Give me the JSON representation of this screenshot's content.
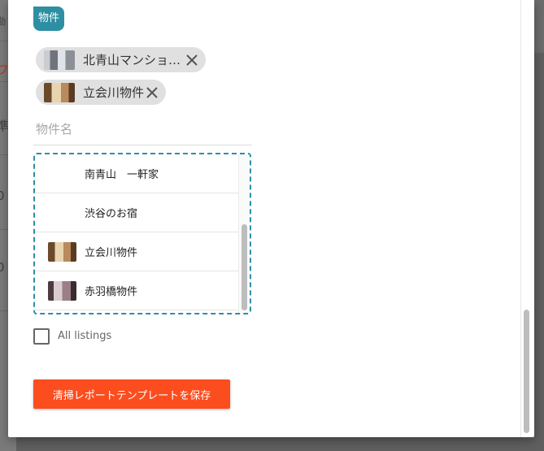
{
  "section": {
    "title": "物件"
  },
  "selected_chips": [
    {
      "label": "北青山マンショ…",
      "thumb_color": "#8b8f96"
    },
    {
      "label": "立会川物件",
      "thumb_color": "#b88a5e"
    }
  ],
  "name_input": {
    "placeholder": "物件名",
    "value": ""
  },
  "listings": [
    {
      "label": "南青山　一軒家",
      "has_thumb": false
    },
    {
      "label": "渋谷のお宿",
      "has_thumb": false
    },
    {
      "label": "立会川物件",
      "has_thumb": true,
      "thumb_color": "#b88a5e"
    },
    {
      "label": "赤羽橋物件",
      "has_thumb": true,
      "thumb_color": "#9a7f86"
    }
  ],
  "all_listings": {
    "label": "All listings",
    "checked": false
  },
  "save_button": {
    "label": "清掃レポートテンプレートを保存"
  },
  "colors": {
    "accent": "#2e8fa3",
    "primary_button": "#fc4d1f"
  },
  "background_page": {
    "fragments": [
      "勤",
      "フ",
      "準",
      "0",
      "0"
    ]
  }
}
